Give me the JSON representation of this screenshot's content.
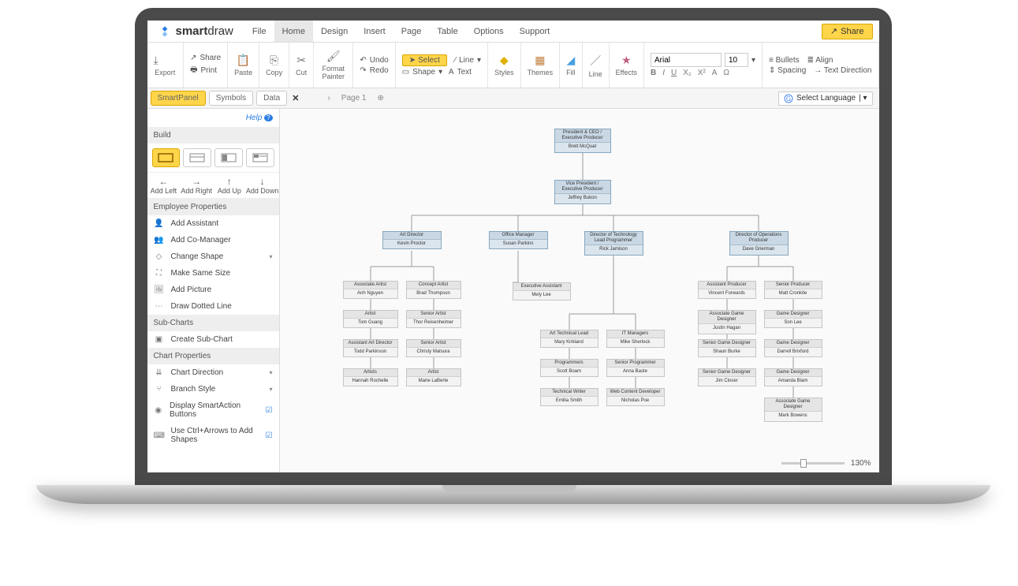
{
  "app": {
    "name_bold": "smart",
    "name_light": "draw"
  },
  "menus": [
    "File",
    "Home",
    "Design",
    "Insert",
    "Page",
    "Table",
    "Options",
    "Support"
  ],
  "active_menu": 1,
  "share": "Share",
  "ribbon": {
    "export": "Export",
    "print": "Print",
    "share": "Share",
    "paste": "Paste",
    "copy": "Copy",
    "cut": "Cut",
    "fmt": "Format Painter",
    "undo": "Undo",
    "redo": "Redo",
    "select": "Select",
    "shape": "Shape",
    "line": "Line",
    "text": "Text",
    "styles": "Styles",
    "themes": "Themes",
    "fill": "Fill",
    "line2": "Line",
    "effects": "Effects",
    "font": "Arial",
    "size": "10",
    "bullets": "Bullets",
    "align": "Align",
    "spacing": "Spacing",
    "tdir": "Text Direction"
  },
  "panel_tabs": [
    "SmartPanel",
    "Symbols",
    "Data"
  ],
  "page": "Page 1",
  "lang": "Select Language",
  "help": "Help",
  "sections": {
    "build": "Build",
    "emp": "Employee Properties",
    "sub": "Sub-Charts",
    "chart": "Chart Properties"
  },
  "dirs": {
    "left": "Add Left",
    "right": "Add Right",
    "up": "Add Up",
    "down": "Add Down"
  },
  "emp_props": [
    "Add Assistant",
    "Add Co-Manager",
    "Change Shape",
    "Make Same Size",
    "Add Picture",
    "Draw Dotted Line"
  ],
  "sub_items": [
    "Create Sub-Chart"
  ],
  "chart_props": [
    "Chart Direction",
    "Branch Style",
    "Display SmartAction Buttons",
    "Use Ctrl+Arrows to Add Shapes"
  ],
  "zoom": "130%",
  "org": {
    "root": {
      "title": "President & CEO / Executive Producer",
      "name": "Brett McQuat"
    },
    "vp": {
      "title": "Vice President / Executive Producer",
      "name": "Jeffrey Bukon"
    },
    "dirs": [
      {
        "title": "Art Director",
        "name": "Kevin Proctor"
      },
      {
        "title": "Office Manager",
        "name": "Susan Parkins"
      },
      {
        "title": "Director of Technology Lead Programmer",
        "name": "Rick Jamison"
      },
      {
        "title": "Director of Operations Producer",
        "name": "Dave Grierman"
      }
    ],
    "col_art_left": [
      {
        "t": "Associate Artist",
        "n": "Anh Nguyen"
      },
      {
        "t": "Artist",
        "n": "Tom Guang"
      },
      {
        "t": "Assistant Art Director",
        "n": "Todd Parkinson"
      },
      {
        "t": "Artists",
        "n": "Hannah Rochelle"
      }
    ],
    "col_art_right": [
      {
        "t": "Concept Artist",
        "n": "Brad Thompson"
      },
      {
        "t": "Senior Artist",
        "n": "Thor Reisenheimer"
      },
      {
        "t": "Senior Artist",
        "n": "Christy Matsura"
      },
      {
        "t": "Artist",
        "n": "Marie LaBerte"
      }
    ],
    "office_asst": {
      "t": "Executive Assistant",
      "n": "Mely Lee"
    },
    "col_tech_left": [
      {
        "t": "Art Technical Lead",
        "n": "Mary Kirkland"
      },
      {
        "t": "Programmers",
        "n": "Scott Boam"
      },
      {
        "t": "Technical Writer",
        "n": "Emilia Smith"
      }
    ],
    "col_tech_right": [
      {
        "t": "IT Managers",
        "n": "Mike Sherlock"
      },
      {
        "t": "Senior Programmer",
        "n": "Anna Baste"
      },
      {
        "t": "Web Content Developer",
        "n": "Nicholas Poe"
      }
    ],
    "col_ops_left": [
      {
        "t": "Assistant Producer",
        "n": "Vincent Forwards"
      },
      {
        "t": "Associate Game Designer",
        "n": "Justin Hagan"
      },
      {
        "t": "Senior Game Designer",
        "n": "Shaun Burke"
      },
      {
        "t": "Senior Game Designer",
        "n": "Jim Closer"
      }
    ],
    "col_ops_right": [
      {
        "t": "Senior Producer",
        "n": "Matt Cronkite"
      },
      {
        "t": "Game Designer",
        "n": "Son Lee"
      },
      {
        "t": "Game Designer",
        "n": "Darrell Brixford"
      },
      {
        "t": "Game Designer",
        "n": "Amanda Blam"
      },
      {
        "t": "Associate Game Designer",
        "n": "Mark Bowens"
      }
    ]
  }
}
